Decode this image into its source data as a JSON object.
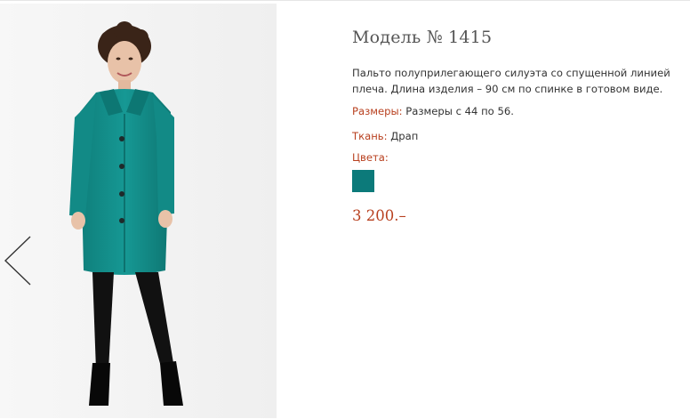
{
  "product": {
    "title": "Модель № 1415",
    "description_line1": "Пальто полуприлегающего силуэта со спущенной линией",
    "description_line2": "плеча.  Длина изделия – 90 см по спинке в готовом виде.",
    "sizes_label": "Размеры:",
    "sizes_value": "Размеры с 44 по 56.",
    "fabric_label": "Ткань:",
    "fabric_value": "Драп",
    "colors_label": "Цвета:",
    "colors": [
      "#0c7a7a"
    ],
    "price": "3 200.–"
  },
  "gallery": {
    "prev_icon": "chevron-left-icon"
  },
  "theme": {
    "accent": "#b8401f",
    "coat": "#138f8b"
  }
}
